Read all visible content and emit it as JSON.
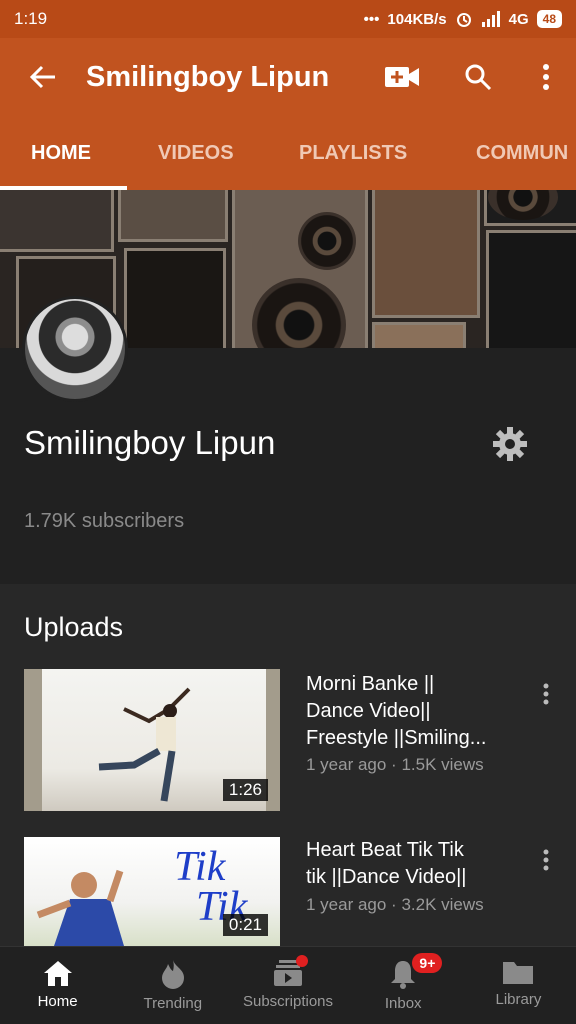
{
  "statusbar": {
    "time": "1:19",
    "network_speed": "104KB/s",
    "network_type": "4G",
    "battery": "48"
  },
  "appbar": {
    "title": "Smilingboy Lipun",
    "icons": [
      "back-arrow-icon",
      "video-add-icon",
      "search-icon",
      "more-vertical-icon"
    ]
  },
  "tabs": [
    "HOME",
    "VIDEOS",
    "PLAYLISTS",
    "COMMUN"
  ],
  "channel": {
    "name": "Smilingboy Lipun",
    "subscribers": "1.79K subscribers"
  },
  "uploads": {
    "heading": "Uploads",
    "videos": [
      {
        "title_lines": [
          "Morni Banke ||",
          "Dance Video||",
          "Freestyle ||Smiling..."
        ],
        "meta": "1 year ago · 1.5K views",
        "duration": "1:26"
      },
      {
        "title_lines": [
          "Heart Beat Tik Tik",
          "tik ||Dance Video||"
        ],
        "meta": "1 year ago · 3.2K views",
        "duration": "0:21",
        "thumb_text": [
          "Tik",
          "Tik"
        ]
      }
    ]
  },
  "bottomnav": {
    "items": [
      {
        "label": "Home",
        "icon": "home-icon"
      },
      {
        "label": "Trending",
        "icon": "flame-icon"
      },
      {
        "label": "Subscriptions",
        "icon": "subscriptions-icon"
      },
      {
        "label": "Inbox",
        "icon": "bell-icon",
        "badge": "9+"
      },
      {
        "label": "Library",
        "icon": "folder-icon"
      }
    ]
  },
  "colors": {
    "accent": "#c1531f",
    "statusbar": "#b84a17",
    "background": "#212121",
    "badge": "#e02020"
  }
}
